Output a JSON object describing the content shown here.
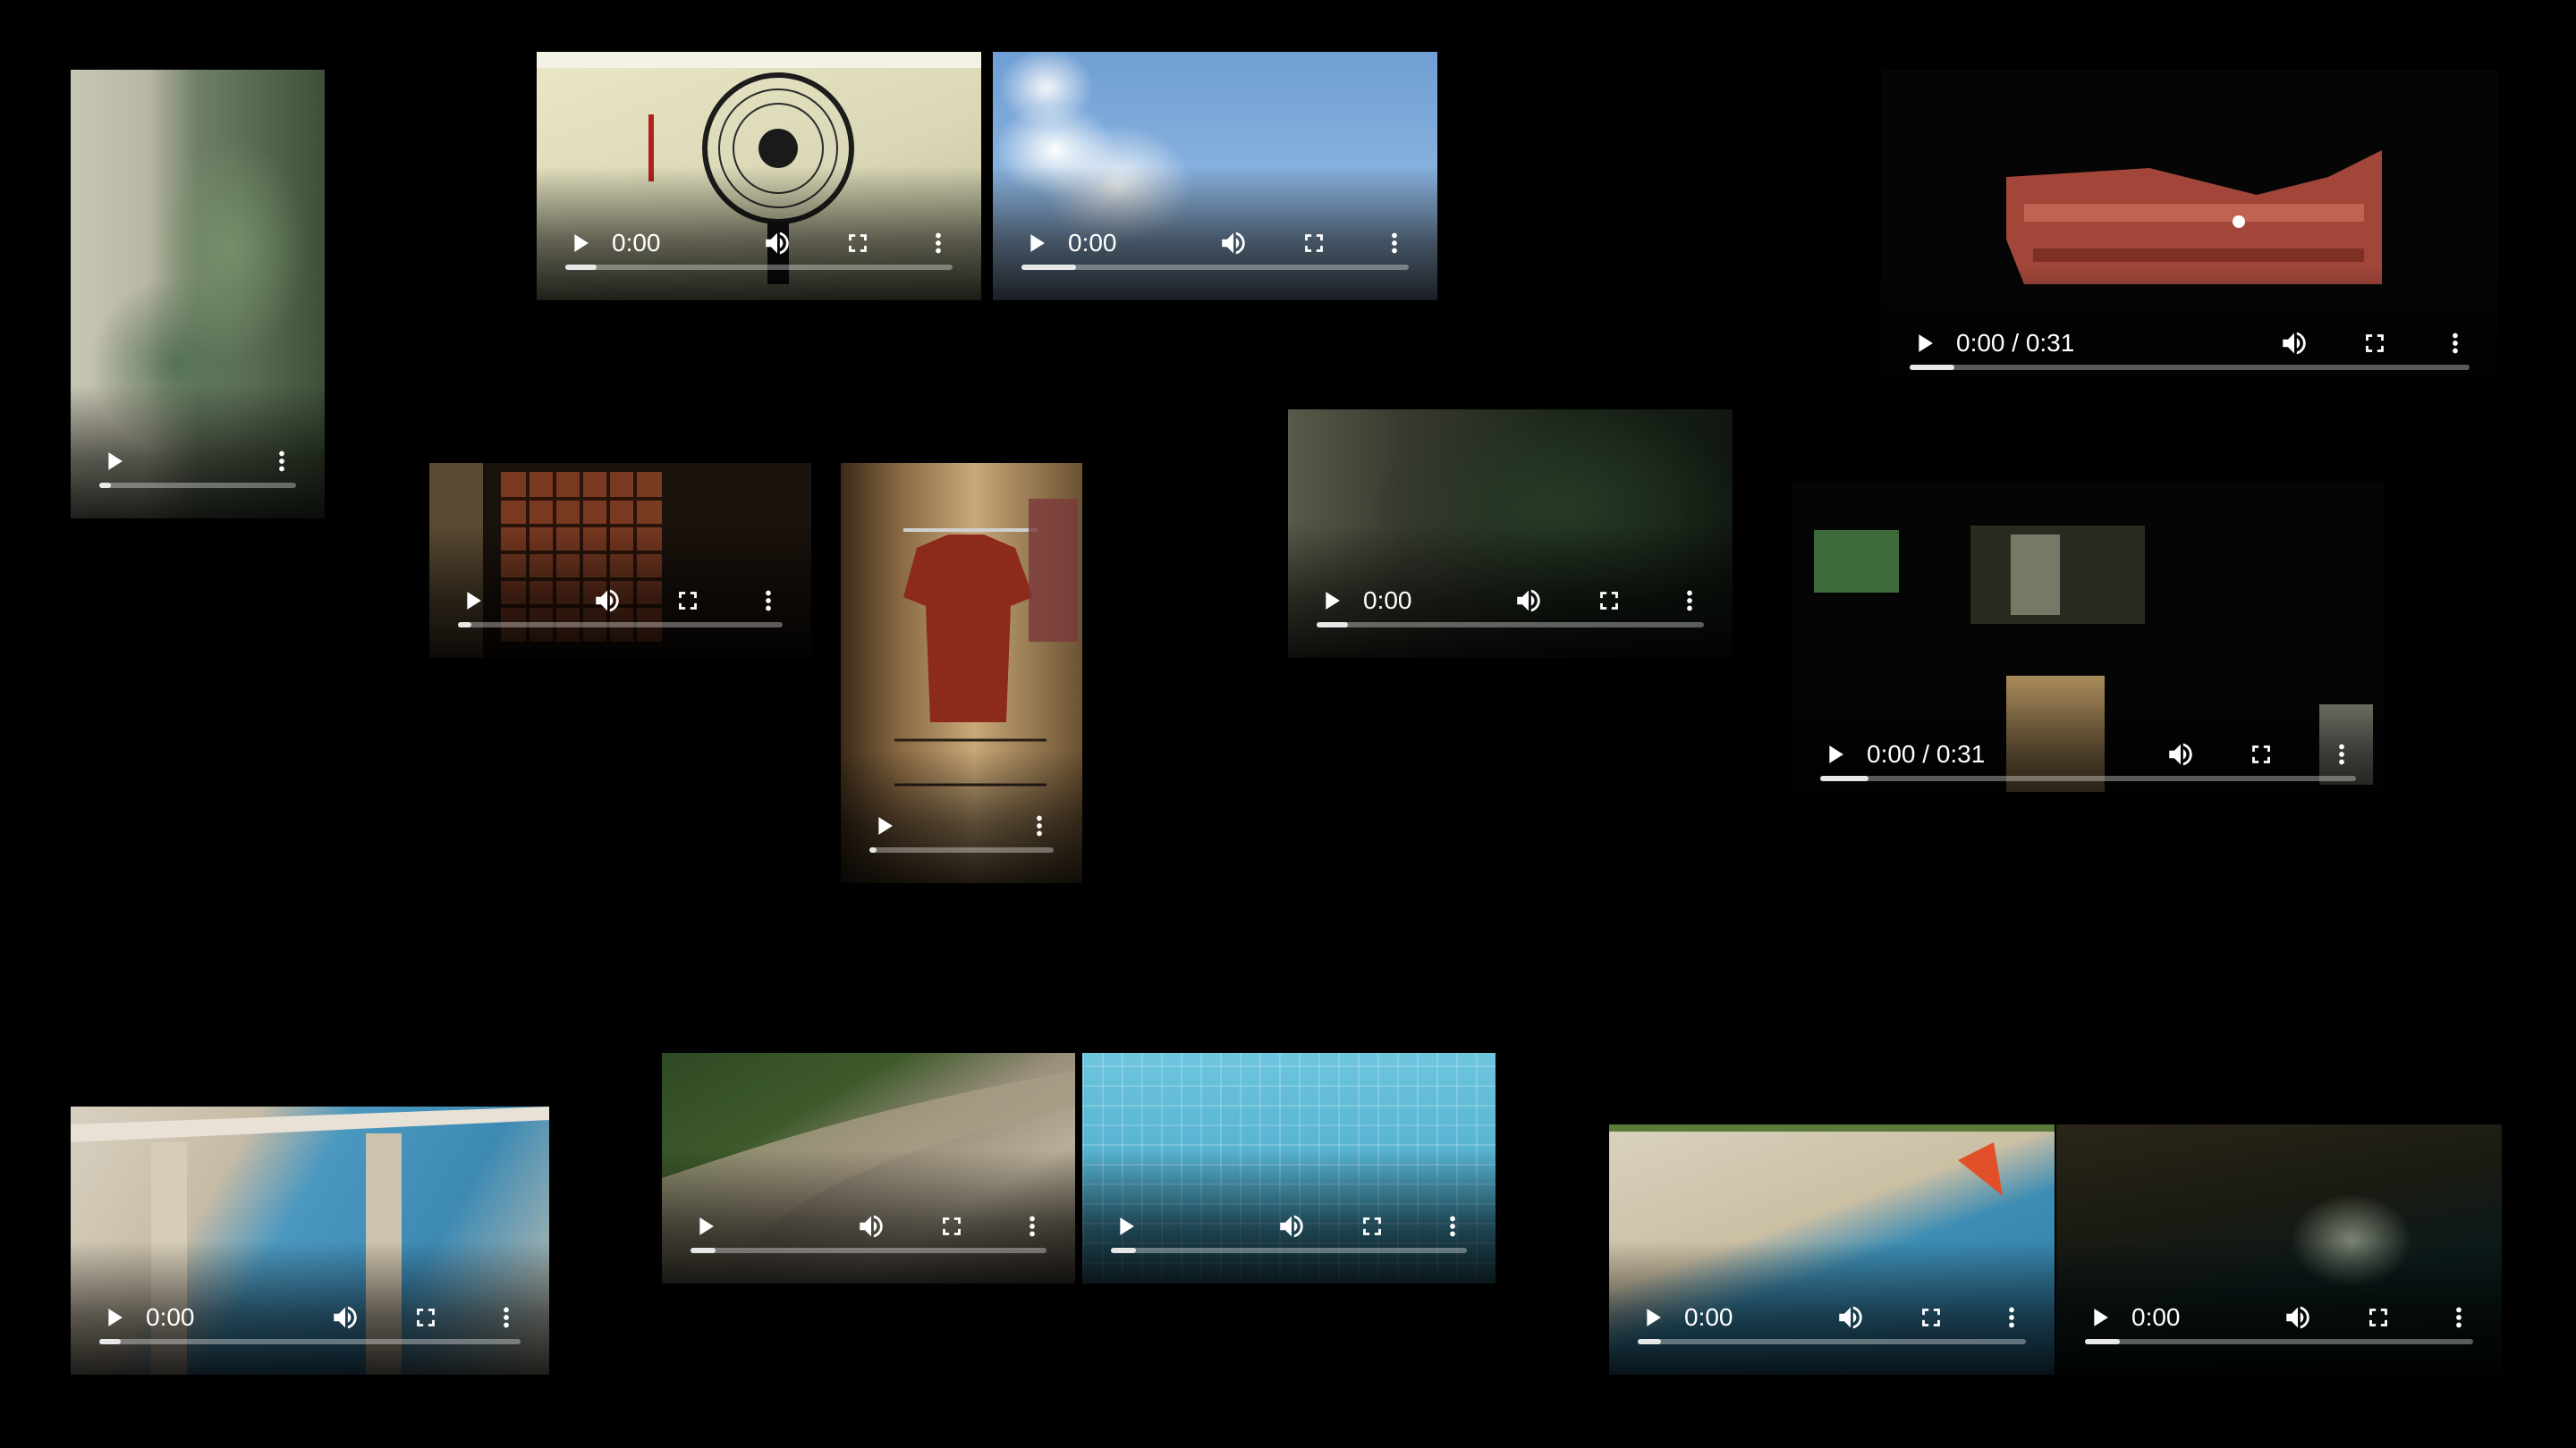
{
  "players": [
    {
      "id": "palm",
      "time": "",
      "progress": 0.06,
      "show_volume": false,
      "show_fullscreen": false
    },
    {
      "id": "fan",
      "time": "0:00",
      "progress": 0.08,
      "show_volume": true,
      "show_fullscreen": true
    },
    {
      "id": "sky",
      "time": "0:00",
      "progress": 0.14,
      "show_volume": true,
      "show_fullscreen": true
    },
    {
      "id": "night-balcony",
      "time": "0:00 / 0:31",
      "progress": 0.08,
      "show_volume": true,
      "show_fullscreen": true
    },
    {
      "id": "window-grille",
      "time": "",
      "progress": 0.04,
      "show_volume": true,
      "show_fullscreen": true
    },
    {
      "id": "shirt",
      "time": "",
      "progress": 0.04,
      "show_volume": false,
      "show_fullscreen": false
    },
    {
      "id": "trees-dim",
      "time": "0:00",
      "progress": 0.08,
      "show_volume": true,
      "show_fullscreen": true
    },
    {
      "id": "night-windows",
      "time": "0:00 / 0:31",
      "progress": 0.09,
      "show_volume": true,
      "show_fullscreen": true
    },
    {
      "id": "pool-pillars",
      "time": "0:00",
      "progress": 0.05,
      "show_volume": true,
      "show_fullscreen": true
    },
    {
      "id": "garden-path",
      "time": "",
      "progress": 0.07,
      "show_volume": true,
      "show_fullscreen": true
    },
    {
      "id": "pool-tiles",
      "time": "",
      "progress": 0.07,
      "show_volume": true,
      "show_fullscreen": true
    },
    {
      "id": "pool-cone",
      "time": "0:00",
      "progress": 0.06,
      "show_volume": true,
      "show_fullscreen": true
    },
    {
      "id": "pool-night",
      "time": "0:00",
      "progress": 0.09,
      "show_volume": true,
      "show_fullscreen": true
    }
  ],
  "icons": {
    "play": "play-icon",
    "volume": "volume-icon",
    "fullscreen": "fullscreen-icon",
    "more": "more-vert-icon"
  }
}
